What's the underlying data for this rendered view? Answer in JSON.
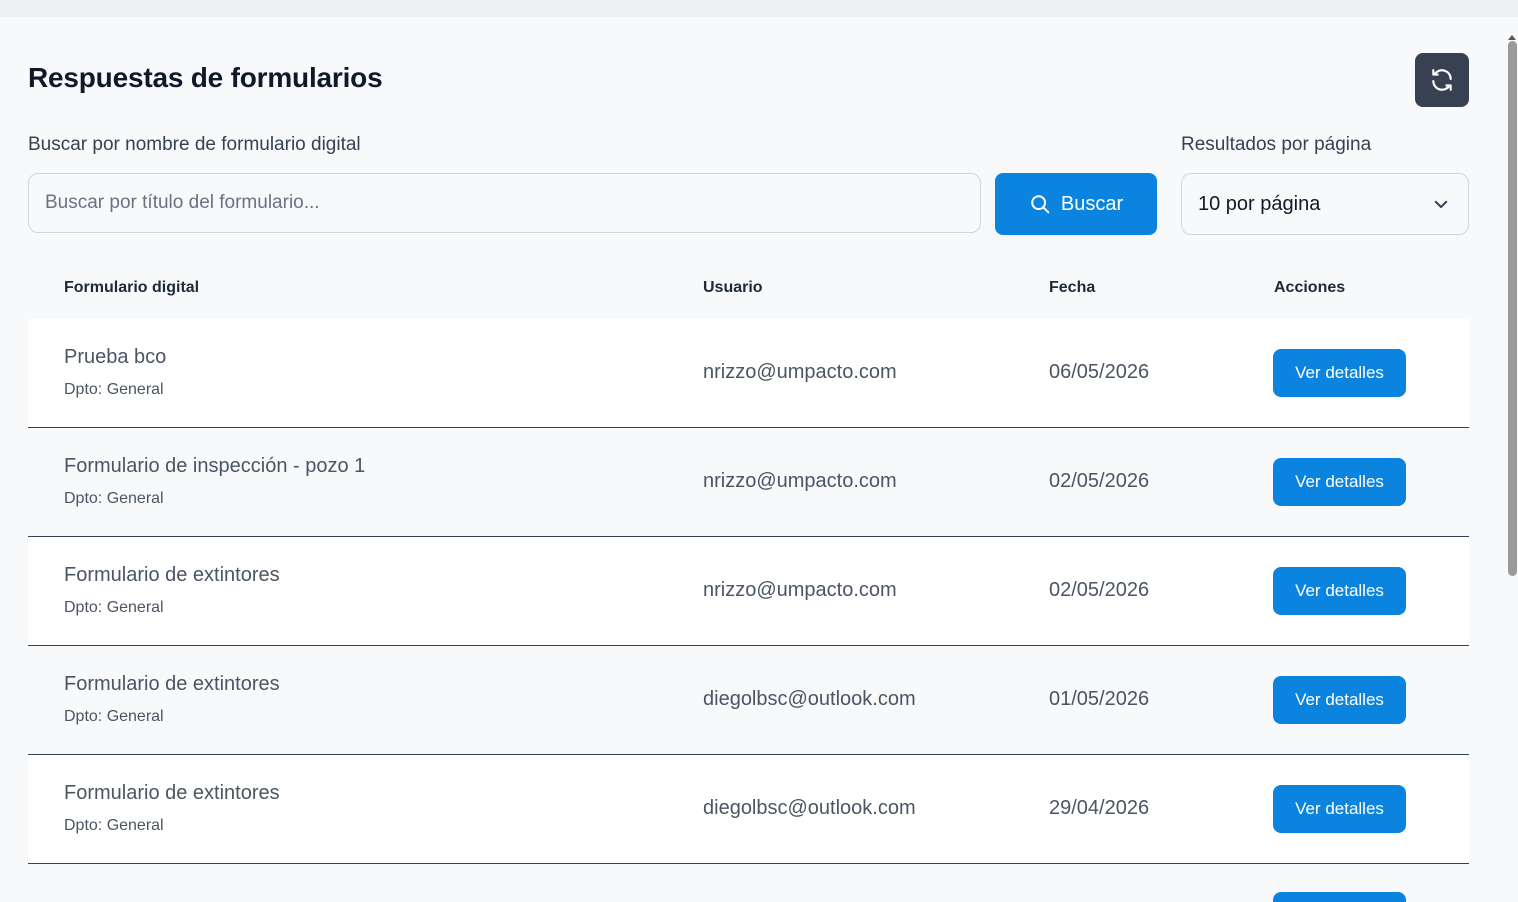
{
  "page": {
    "title": "Respuestas de formularios"
  },
  "refresh": {
    "icon": "refresh-icon"
  },
  "search": {
    "label": "Buscar por nombre de formulario digital",
    "placeholder": "Buscar por título del formulario...",
    "value": "",
    "button_label": "Buscar",
    "button_icon": "search-icon"
  },
  "per_page": {
    "label": "Resultados por página",
    "selected": "10 por página",
    "icon": "chevron-down-icon"
  },
  "table": {
    "headers": {
      "form": "Formulario digital",
      "user": "Usuario",
      "date": "Fecha",
      "actions": "Acciones"
    },
    "rows": [
      {
        "title": "Prueba bco",
        "dept": "Dpto: General",
        "user": "nrizzo@umpacto.com",
        "date": "06/05/2026",
        "action": "Ver detalles"
      },
      {
        "title": "Formulario de inspección - pozo 1",
        "dept": "Dpto: General",
        "user": "nrizzo@umpacto.com",
        "date": "02/05/2026",
        "action": "Ver detalles"
      },
      {
        "title": "Formulario de extintores",
        "dept": "Dpto: General",
        "user": "nrizzo@umpacto.com",
        "date": "02/05/2026",
        "action": "Ver detalles"
      },
      {
        "title": "Formulario de extintores",
        "dept": "Dpto: General",
        "user": "diegolbsc@outlook.com",
        "date": "01/05/2026",
        "action": "Ver detalles"
      },
      {
        "title": "Formulario de extintores",
        "dept": "Dpto: General",
        "user": "diegolbsc@outlook.com",
        "date": "29/04/2026",
        "action": "Ver detalles"
      }
    ]
  },
  "colors": {
    "primary": "#0b84e0",
    "dark_button": "#374151",
    "row_divider": "#374151"
  }
}
